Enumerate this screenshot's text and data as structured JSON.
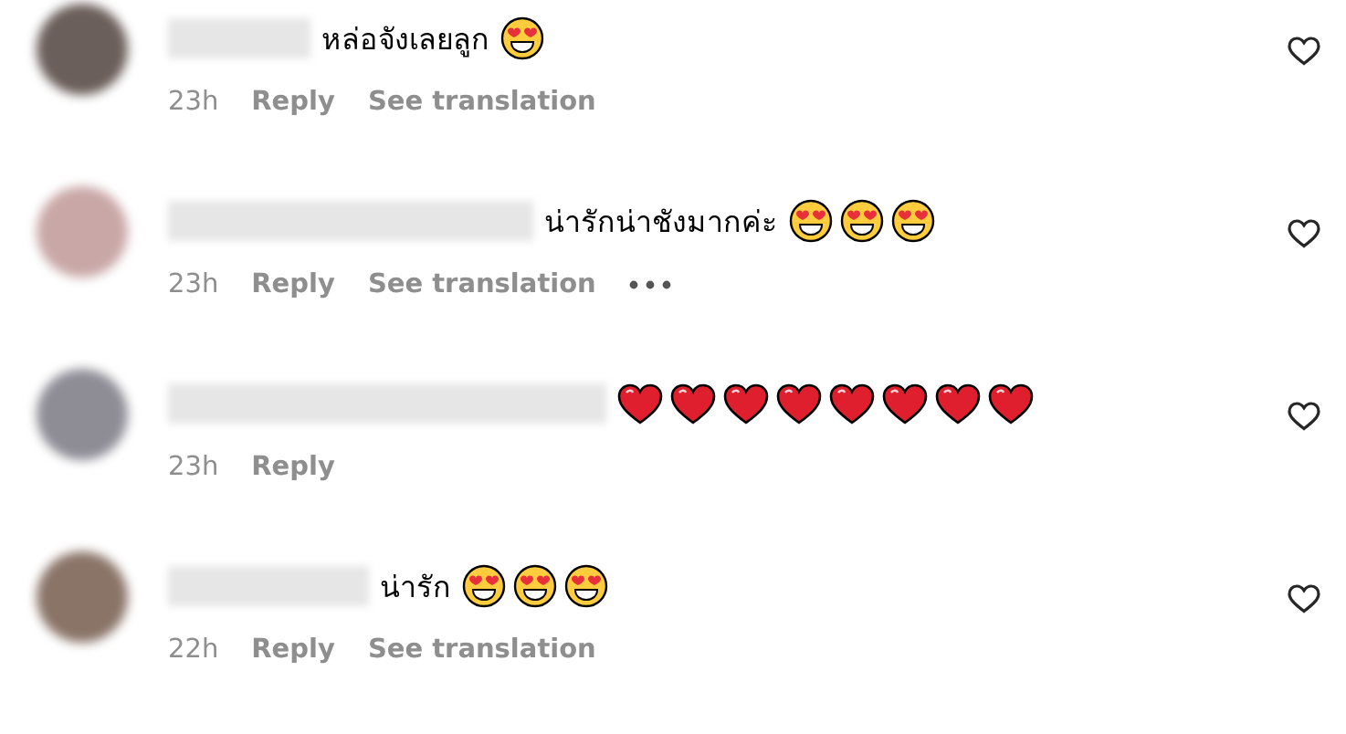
{
  "comments": [
    {
      "text": "หล่อจังเลยลูก",
      "emojis": [
        {
          "kind": "heart-eyes"
        }
      ],
      "time": "23h",
      "reply": "Reply",
      "translate": "See translation",
      "more_menu": false,
      "liked": false
    },
    {
      "text": "น่ารักน่าชังมากค่ะ",
      "emojis": [
        {
          "kind": "heart-eyes"
        },
        {
          "kind": "heart-eyes"
        },
        {
          "kind": "heart-eyes"
        }
      ],
      "time": "23h",
      "reply": "Reply",
      "translate": "See translation",
      "more_menu": true,
      "liked": false
    },
    {
      "emojis": [
        {
          "kind": "red-heart"
        },
        {
          "kind": "red-heart"
        },
        {
          "kind": "red-heart"
        },
        {
          "kind": "red-heart"
        },
        {
          "kind": "red-heart"
        },
        {
          "kind": "red-heart"
        },
        {
          "kind": "red-heart"
        },
        {
          "kind": "red-heart"
        }
      ],
      "time": "23h",
      "reply": "Reply",
      "more_menu": false,
      "liked": false
    },
    {
      "text": "น่ารัก",
      "emojis": [
        {
          "kind": "heart-eyes"
        },
        {
          "kind": "heart-eyes"
        },
        {
          "kind": "heart-eyes"
        }
      ],
      "time": "22h",
      "reply": "Reply",
      "translate": "See translation",
      "more_menu": false,
      "liked": false
    }
  ]
}
